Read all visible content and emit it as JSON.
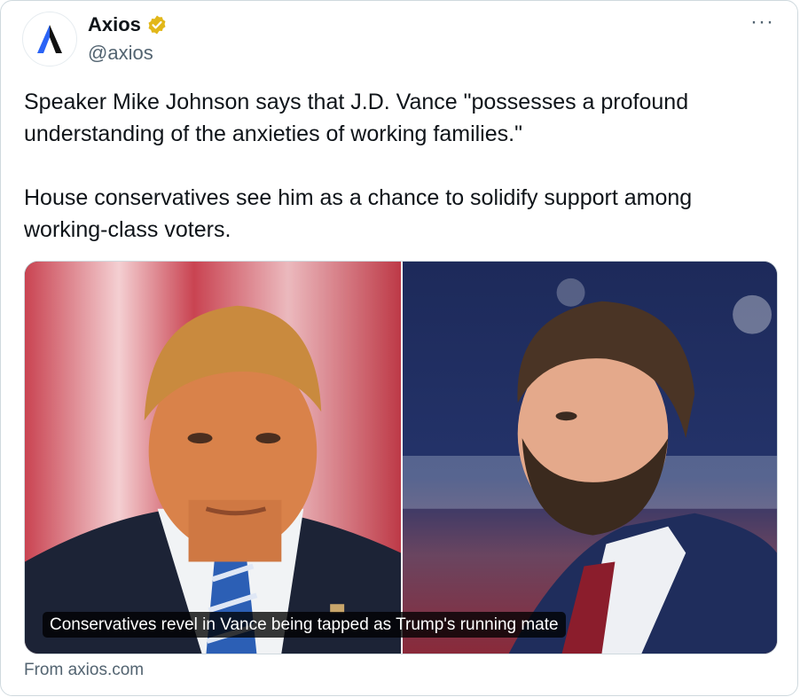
{
  "account": {
    "name": "Axios",
    "handle": "@axios",
    "verified_color": "#e2b719",
    "logo_color": "#111111",
    "logo_accent": "#2a63f6"
  },
  "tweet": {
    "paragraph1": "Speaker Mike Johnson says that J.D. Vance \"possesses a profound understanding of the anxieties of working families.\"",
    "paragraph2": "House conservatives see him as a chance to solidify support among working-class voters."
  },
  "card": {
    "caption": "Conservatives revel in Vance being tapped as Trump's running mate",
    "source": "From axios.com"
  },
  "icons": {
    "more": "more-options-icon",
    "verified": "verified-badge-icon",
    "logo": "axios-logo-icon"
  },
  "more_label": "···"
}
